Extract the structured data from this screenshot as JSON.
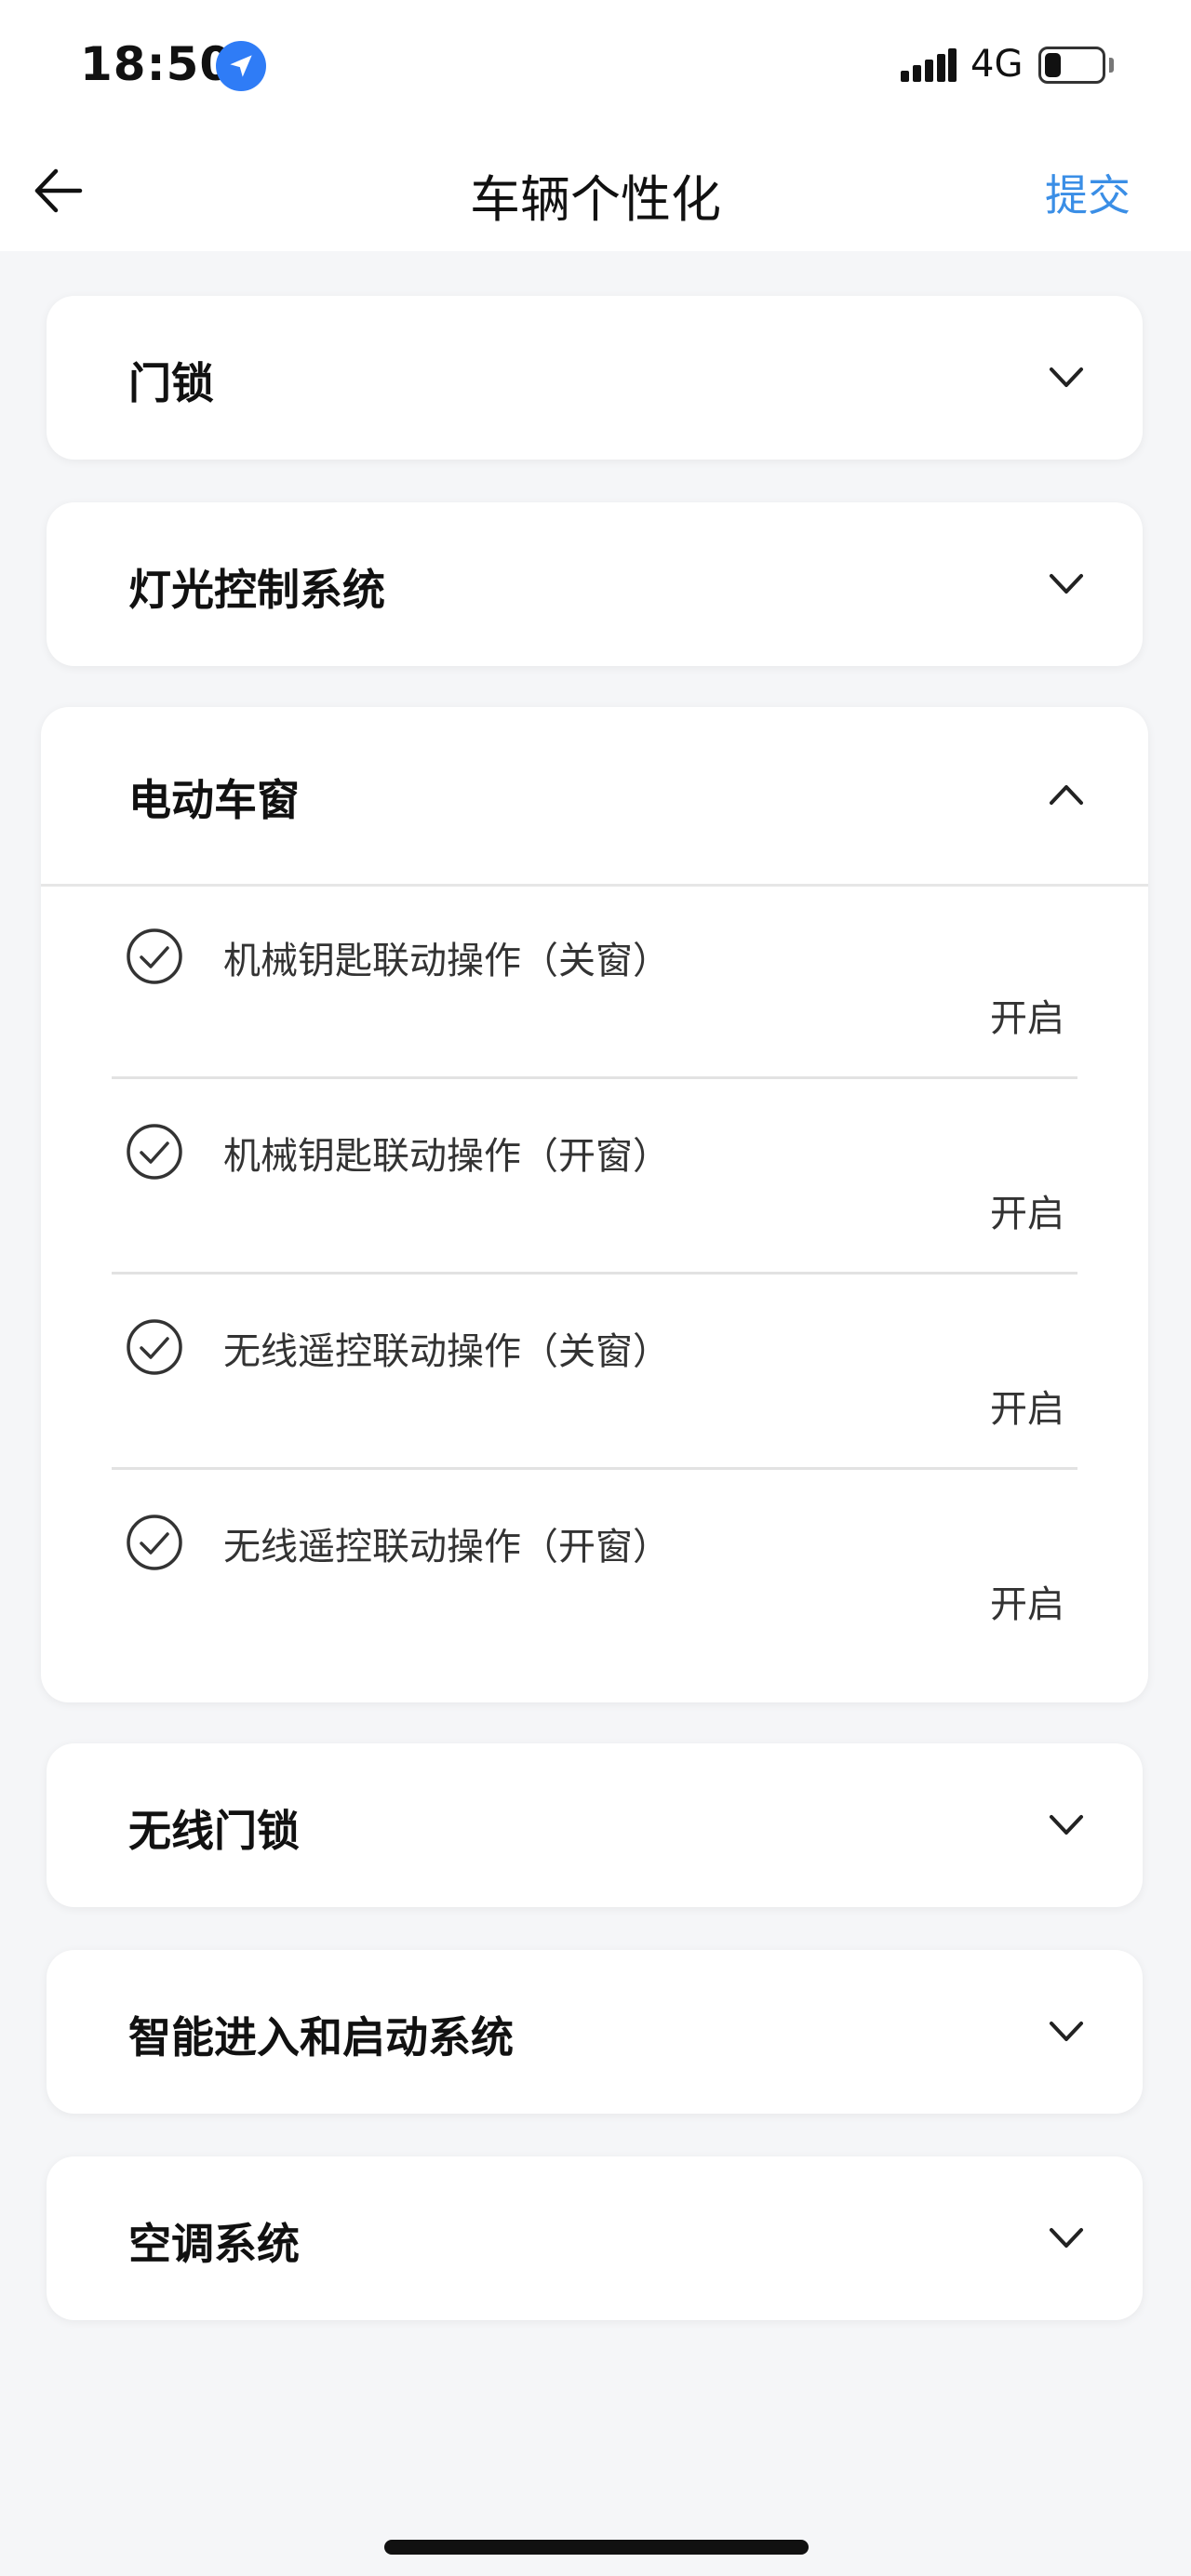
{
  "status_bar": {
    "time": "18:50",
    "network": "4G",
    "battery_level": 0.3,
    "icons": [
      "location-arrow-icon",
      "signal-icon",
      "battery-icon"
    ]
  },
  "header": {
    "title": "车辆个性化",
    "submit_label": "提交",
    "back_icon": "arrow-left-icon",
    "accent_color": "#3a8ee6"
  },
  "sections": [
    {
      "title": "门锁",
      "expanded": false
    },
    {
      "title": "灯光控制系统",
      "expanded": false
    },
    {
      "title": "电动车窗",
      "expanded": true,
      "items": [
        {
          "label": "机械钥匙联动操作（关窗）",
          "value": "开启",
          "checked": true
        },
        {
          "label": "机械钥匙联动操作（开窗）",
          "value": "开启",
          "checked": true
        },
        {
          "label": "无线遥控联动操作（关窗）",
          "value": "开启",
          "checked": true
        },
        {
          "label": "无线遥控联动操作（开窗）",
          "value": "开启",
          "checked": true
        }
      ]
    },
    {
      "title": "无线门锁",
      "expanded": false
    },
    {
      "title": "智能进入和启动系统",
      "expanded": false
    },
    {
      "title": "空调系统",
      "expanded": false
    }
  ]
}
